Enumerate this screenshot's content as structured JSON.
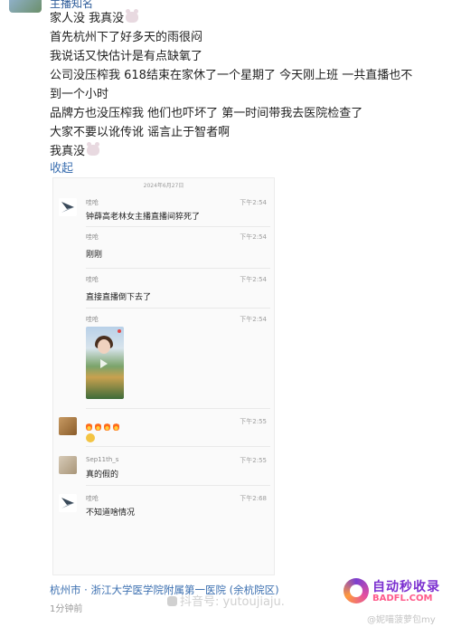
{
  "header": {
    "user_name": "主播知名"
  },
  "post": {
    "lines": [
      "家人没 我真没",
      "首先杭州下了好多天的雨很闷",
      "我说话又快估计是有点缺氧了",
      "公司没压榨我 618结束在家休了一个星期了  今天刚上班 一共直播也不",
      "到一个小时",
      "品牌方也没压榨我 他们也吓坏了 第一时间带我去医院检查了",
      "大家不要以讹传讹 谣言止于智者啊",
      "我真没"
    ],
    "collapse_label": "收起"
  },
  "chat_screenshot": {
    "date": "2024年6月27日",
    "messages": [
      {
        "name": "哇呛",
        "time": "下午2:54",
        "text": "钟薛高老林女主播直播间猝死了",
        "avatar": "logo-avatar"
      },
      {
        "name": "哇呛",
        "time": "下午2:54",
        "text": "刚刚",
        "avatar": "logo-avatar"
      },
      {
        "name": "哇呛",
        "time": "下午2:54",
        "text": "直接直播倒下去了",
        "avatar": "logo-avatar"
      },
      {
        "name": "哇呛",
        "time": "下午2:54",
        "text": "",
        "avatar": "logo-avatar"
      },
      {
        "name": "",
        "time": "下午2:55",
        "text": "",
        "avatar": "cat-avatar"
      },
      {
        "name": "Sep11th_s",
        "time": "下午2:55",
        "text": "真的假的",
        "avatar": "dog-avatar"
      },
      {
        "name": "哇呛",
        "time": "下午2:68",
        "text": "不知道啥情况",
        "avatar": "logo-avatar"
      }
    ]
  },
  "footer": {
    "location": "杭州市 · 浙江大学医学院附属第一医院 (余杭院区)",
    "time_ago": "1分钟前",
    "watermark": "抖音号: yutoujiaju.",
    "site_name_cn": "自动秒收录",
    "site_name_en": "BADFL.COM",
    "credit": "@妮喵菠萝包my"
  },
  "colors": {
    "link": "#3b6fb0",
    "text": "#1f1f1f",
    "muted": "#9a9a9a"
  }
}
